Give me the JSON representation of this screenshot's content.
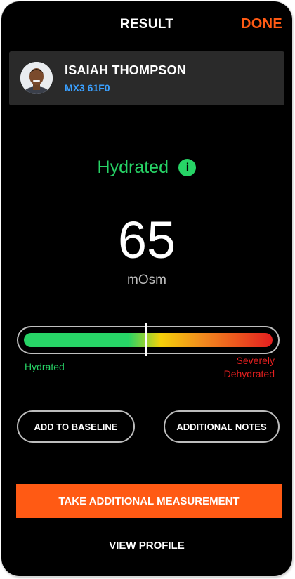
{
  "header": {
    "title": "RESULT",
    "done_label": "DONE"
  },
  "user": {
    "name": "ISAIAH THOMPSON",
    "device_id": "MX3 61F0"
  },
  "status": {
    "label": "Hydrated",
    "info_icon": "info-icon"
  },
  "reading": {
    "value": "65",
    "unit": "mOsm"
  },
  "gauge": {
    "low_label": "Hydrated",
    "high_label": "Severely Dehydrated",
    "marker_fraction": 0.49
  },
  "actions": {
    "baseline_label": "ADD TO BASELINE",
    "notes_label": "ADDITIONAL NOTES",
    "take_measurement_label": "TAKE ADDITIONAL MEASUREMENT",
    "view_profile_label": "VIEW PROFILE"
  },
  "colors": {
    "accent": "#ff5a14",
    "hydrated": "#27d466",
    "dehydrated": "#e51f1f",
    "device_link": "#3aa0ff"
  }
}
